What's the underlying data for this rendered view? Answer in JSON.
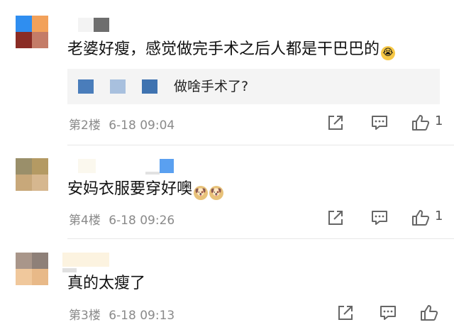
{
  "comments": [
    {
      "text": "老婆好瘦，感觉做完手术之后人都是干巴巴的",
      "emoji": "crying-emoji",
      "reply": {
        "text": "做啥手术了?"
      },
      "floor": "第2楼",
      "time": "6-18 09:04",
      "likes": "1"
    },
    {
      "text": "安妈衣服要穿好噢",
      "emoji": "doge-emoji",
      "floor": "第4楼",
      "time": "6-18 09:26",
      "likes": "1"
    },
    {
      "text": "真的太瘦了",
      "floor": "第3楼",
      "time": "6-18 09:13"
    }
  ],
  "icons": {
    "share": "share-icon",
    "comment": "comment-icon",
    "like": "thumbs-up-icon"
  },
  "colors": {
    "meta": "#8a8a8a",
    "icon": "#666666",
    "reply_bg": "#f4f4f4"
  }
}
